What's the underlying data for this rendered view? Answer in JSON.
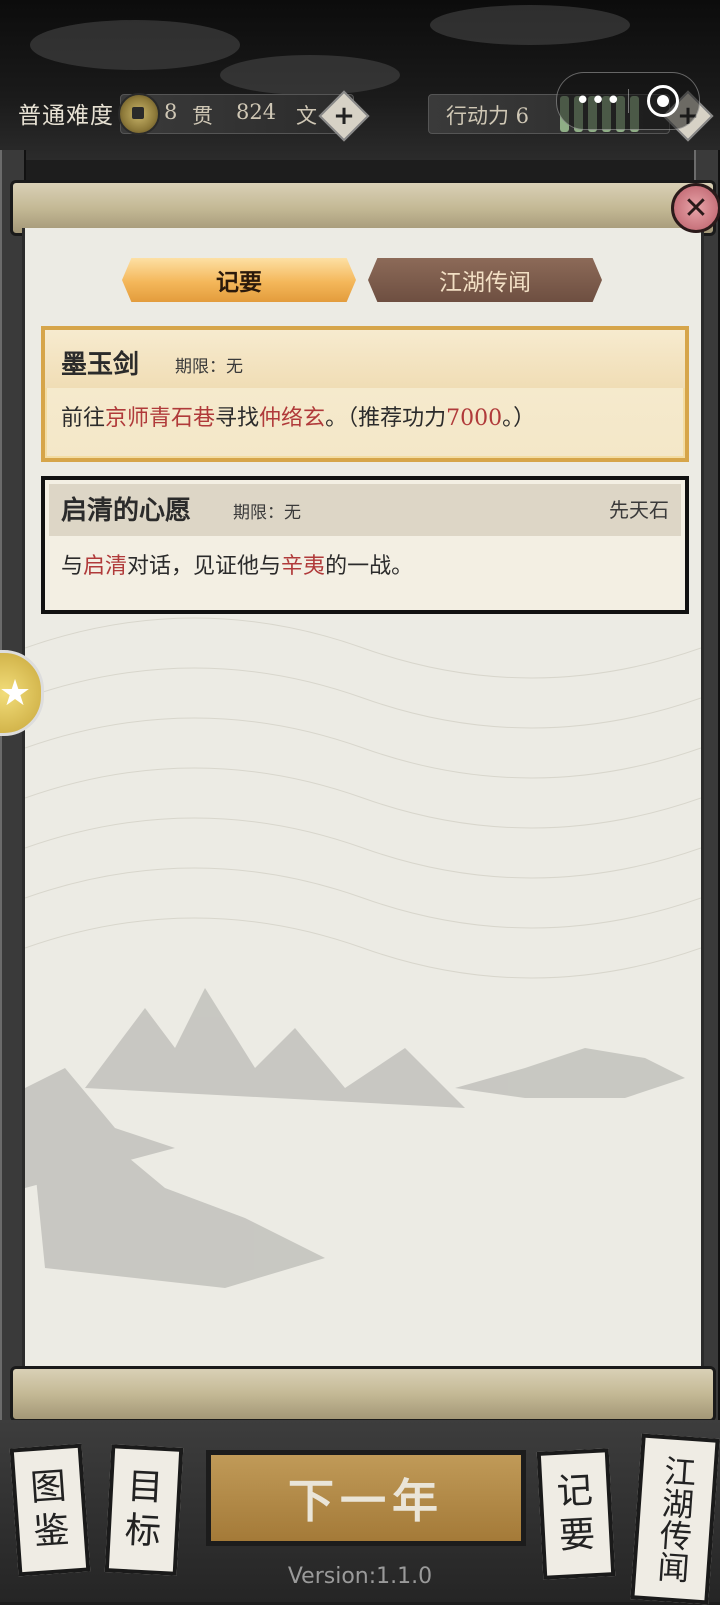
{
  "top_bar": {
    "difficulty": "普通难度",
    "currency": {
      "guan_amount": "8",
      "guan_unit": "贯",
      "wen_amount": "824",
      "wen_unit": "文"
    },
    "action_points_label": "行动力 6",
    "add_symbol": "+",
    "menu_dots": "•••"
  },
  "tabs": [
    {
      "label": "记要",
      "active": true
    },
    {
      "label": "江湖传闻",
      "active": false
    }
  ],
  "close_symbol": "✕",
  "side_badge_symbol": "★",
  "quests": [
    {
      "title": "墨玉剑",
      "limit": "期限：无",
      "reward": "",
      "desc_parts": [
        {
          "text": "前往",
          "highlight": false
        },
        {
          "text": "京师青石巷",
          "highlight": true
        },
        {
          "text": "寻找",
          "highlight": false
        },
        {
          "text": "仲络玄",
          "highlight": true
        },
        {
          "text": "。（推荐功力",
          "highlight": false
        },
        {
          "text": "7000",
          "highlight": true
        },
        {
          "text": "。）",
          "highlight": false
        }
      ]
    },
    {
      "title": "启清的心愿",
      "limit": "期限：无",
      "reward": "先天石",
      "desc_parts": [
        {
          "text": "与",
          "highlight": false
        },
        {
          "text": "启清",
          "highlight": true
        },
        {
          "text": "对话，见证他与",
          "highlight": false
        },
        {
          "text": "辛夷",
          "highlight": true
        },
        {
          "text": "的一战。",
          "highlight": false
        }
      ]
    }
  ],
  "bottom": {
    "left_cards": [
      {
        "line1": "图",
        "line2": "鉴"
      },
      {
        "line1": "目",
        "line2": "标"
      }
    ],
    "next_year": "下一年",
    "right_cards": [
      {
        "line1": "记",
        "line2": "要"
      },
      {
        "line1": "江湖",
        "line2": "传闻"
      }
    ],
    "version": "Version:1.1.0"
  },
  "colors": {
    "highlight": "#b03a3a",
    "tab_active": "#f4b75a",
    "tab_inactive": "#6e4f41",
    "gold_border": "#d6a54a"
  }
}
